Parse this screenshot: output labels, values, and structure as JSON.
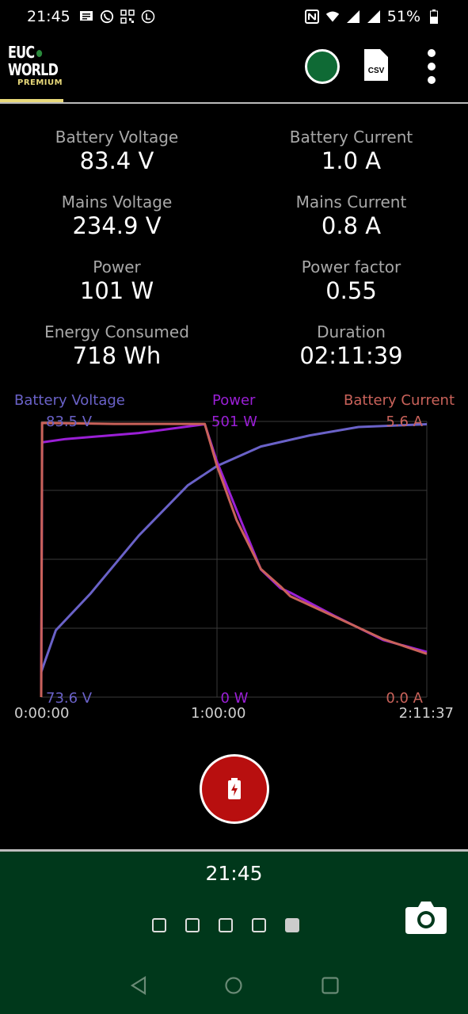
{
  "status_bar": {
    "time": "21:45",
    "battery_percent": "51%",
    "icons_left": [
      "message-icon",
      "whatsapp-icon",
      "qr-icon",
      "l-circle-icon"
    ],
    "icons_right": [
      "nfc-icon",
      "wifi-icon",
      "signal-icon",
      "signal-icon",
      "battery-icon"
    ]
  },
  "app_bar": {
    "logo_line1": "EUC",
    "logo_line2": "WORLD",
    "logo_tag": "PREMIUM",
    "csv_label": "CSV",
    "colors": {
      "accent": "#e8d97a",
      "connection": "#0f6a35"
    }
  },
  "metrics": [
    {
      "label": "Battery Voltage",
      "value": "83.4 V"
    },
    {
      "label": "Battery Current",
      "value": "1.0 A"
    },
    {
      "label": "Mains Voltage",
      "value": "234.9 V"
    },
    {
      "label": "Mains Current",
      "value": "0.8 A"
    },
    {
      "label": "Power",
      "value": "101 W"
    },
    {
      "label": "Power factor",
      "value": "0.55"
    },
    {
      "label": "Energy Consumed",
      "value": "718 Wh"
    },
    {
      "label": "Duration",
      "value": "02:11:39"
    }
  ],
  "chart_data": {
    "type": "line",
    "x_unit": "seconds",
    "x_ticks": [
      "0:00:00",
      "1:00:00",
      "2:11:37"
    ],
    "xlim": [
      0,
      7897
    ],
    "series": [
      {
        "name": "Battery Voltage",
        "color": "#6a62c8",
        "max_label": "83.5 V",
        "min_label": "73.6 V",
        "ylim": [
          73.6,
          83.5
        ],
        "points": [
          [
            0,
            74.5
          ],
          [
            300,
            76.0
          ],
          [
            1000,
            77.3
          ],
          [
            2000,
            79.4
          ],
          [
            3000,
            81.2
          ],
          [
            3600,
            81.9
          ],
          [
            4500,
            82.6
          ],
          [
            5500,
            83.0
          ],
          [
            6500,
            83.3
          ],
          [
            7897,
            83.4
          ]
        ]
      },
      {
        "name": "Power",
        "color": "#9a1fd6",
        "max_label": "501 W",
        "min_label": "0 W",
        "ylim": [
          0,
          501
        ],
        "points": [
          [
            0,
            0
          ],
          [
            20,
            463
          ],
          [
            500,
            469
          ],
          [
            2000,
            480
          ],
          [
            3350,
            496
          ],
          [
            3600,
            428
          ],
          [
            4000,
            340
          ],
          [
            4500,
            232
          ],
          [
            4900,
            198
          ],
          [
            5100,
            190
          ],
          [
            6000,
            148
          ],
          [
            7000,
            104
          ],
          [
            7897,
            82
          ]
        ]
      },
      {
        "name": "Battery Current",
        "color": "#c9625a",
        "max_label": "5.6 A",
        "min_label": "0.0 A",
        "ylim": [
          0,
          5.6
        ],
        "points": [
          [
            0,
            0
          ],
          [
            20,
            5.57
          ],
          [
            1500,
            5.55
          ],
          [
            3350,
            5.55
          ],
          [
            3600,
            4.7
          ],
          [
            4000,
            3.6
          ],
          [
            4500,
            2.6
          ],
          [
            4900,
            2.25
          ],
          [
            5100,
            2.05
          ],
          [
            6000,
            1.64
          ],
          [
            7000,
            1.18
          ],
          [
            7897,
            0.88
          ]
        ]
      }
    ],
    "grid": true
  },
  "controls": {
    "footer_time": "21:45",
    "pages": 5,
    "active_page": 4
  }
}
